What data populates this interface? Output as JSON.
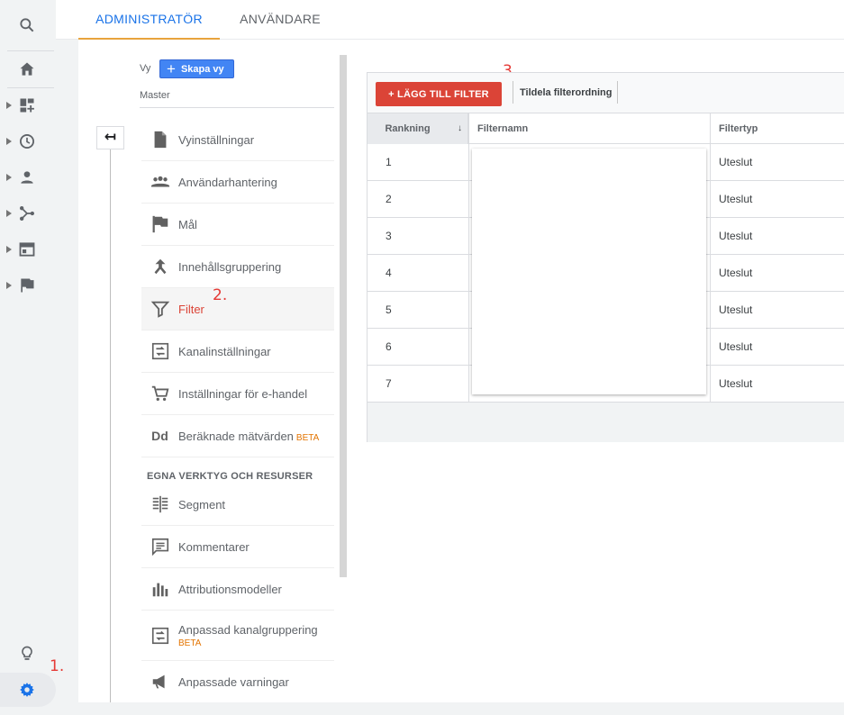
{
  "tabs": [
    {
      "label": "ADMINISTRATÖR",
      "active": true
    },
    {
      "label": "ANVÄNDARE",
      "active": false
    }
  ],
  "rail": {
    "icons": [
      "search-icon",
      "home-icon",
      "dashboard-icon",
      "clock-icon",
      "person-icon",
      "acquisition-icon",
      "behavior-icon",
      "flag-icon",
      "lightbulb-icon",
      "gear-icon"
    ]
  },
  "view": {
    "label": "Vy",
    "create_button": "Skapa vy",
    "selected_view": "Master"
  },
  "menu": {
    "items": [
      {
        "label": "Vyinställningar",
        "icon": "document-icon"
      },
      {
        "label": "Användarhantering",
        "icon": "people-icon"
      },
      {
        "label": "Mål",
        "icon": "flag-icon"
      },
      {
        "label": "Innehållsgruppering",
        "icon": "merge-icon"
      },
      {
        "label": "Filter",
        "icon": "filter-icon"
      },
      {
        "label": "Kanalinställningar",
        "icon": "channel-icon"
      },
      {
        "label": "Inställningar för e-handel",
        "icon": "cart-icon"
      },
      {
        "label": "Beräknade mätvärden",
        "icon": "dd-icon",
        "badge": "BETA"
      }
    ],
    "section_title": "EGNA VERKTYG OCH RESURSER",
    "tools": [
      {
        "label": "Segment",
        "icon": "segment-icon"
      },
      {
        "label": "Kommentarer",
        "icon": "comment-icon"
      },
      {
        "label": "Attributionsmodeller",
        "icon": "bar-chart-icon"
      },
      {
        "label": "Anpassad kanalgruppering",
        "icon": "channel-icon",
        "badge": "BETA"
      },
      {
        "label": "Anpassade varningar",
        "icon": "megaphone-icon"
      }
    ],
    "back_glyph": "↤"
  },
  "annotations": [
    "1.",
    "2.",
    "3."
  ],
  "filters": {
    "add_button": "+ LÄGG TILL FILTER",
    "order_link": "Tildela filterordning",
    "columns": [
      "Rankning",
      "Filternamn",
      "Filtertyp"
    ],
    "sort_glyph": "↓",
    "rows": [
      {
        "rank": "1",
        "name": "",
        "type": "Uteslut"
      },
      {
        "rank": "2",
        "name": "",
        "type": "Uteslut"
      },
      {
        "rank": "3",
        "name": "",
        "type": "Uteslut"
      },
      {
        "rank": "4",
        "name": "",
        "type": "Uteslut"
      },
      {
        "rank": "5",
        "name": "",
        "type": "Uteslut"
      },
      {
        "rank": "6",
        "name": "",
        "type": "Uteslut"
      },
      {
        "rank": "7",
        "name": "",
        "type": "Uteslut"
      }
    ]
  },
  "colors": {
    "accent_blue": "#1a73e8",
    "filter_red": "#db4437",
    "tab_underline": "#e8a33d",
    "beta_orange": "#e37400"
  }
}
